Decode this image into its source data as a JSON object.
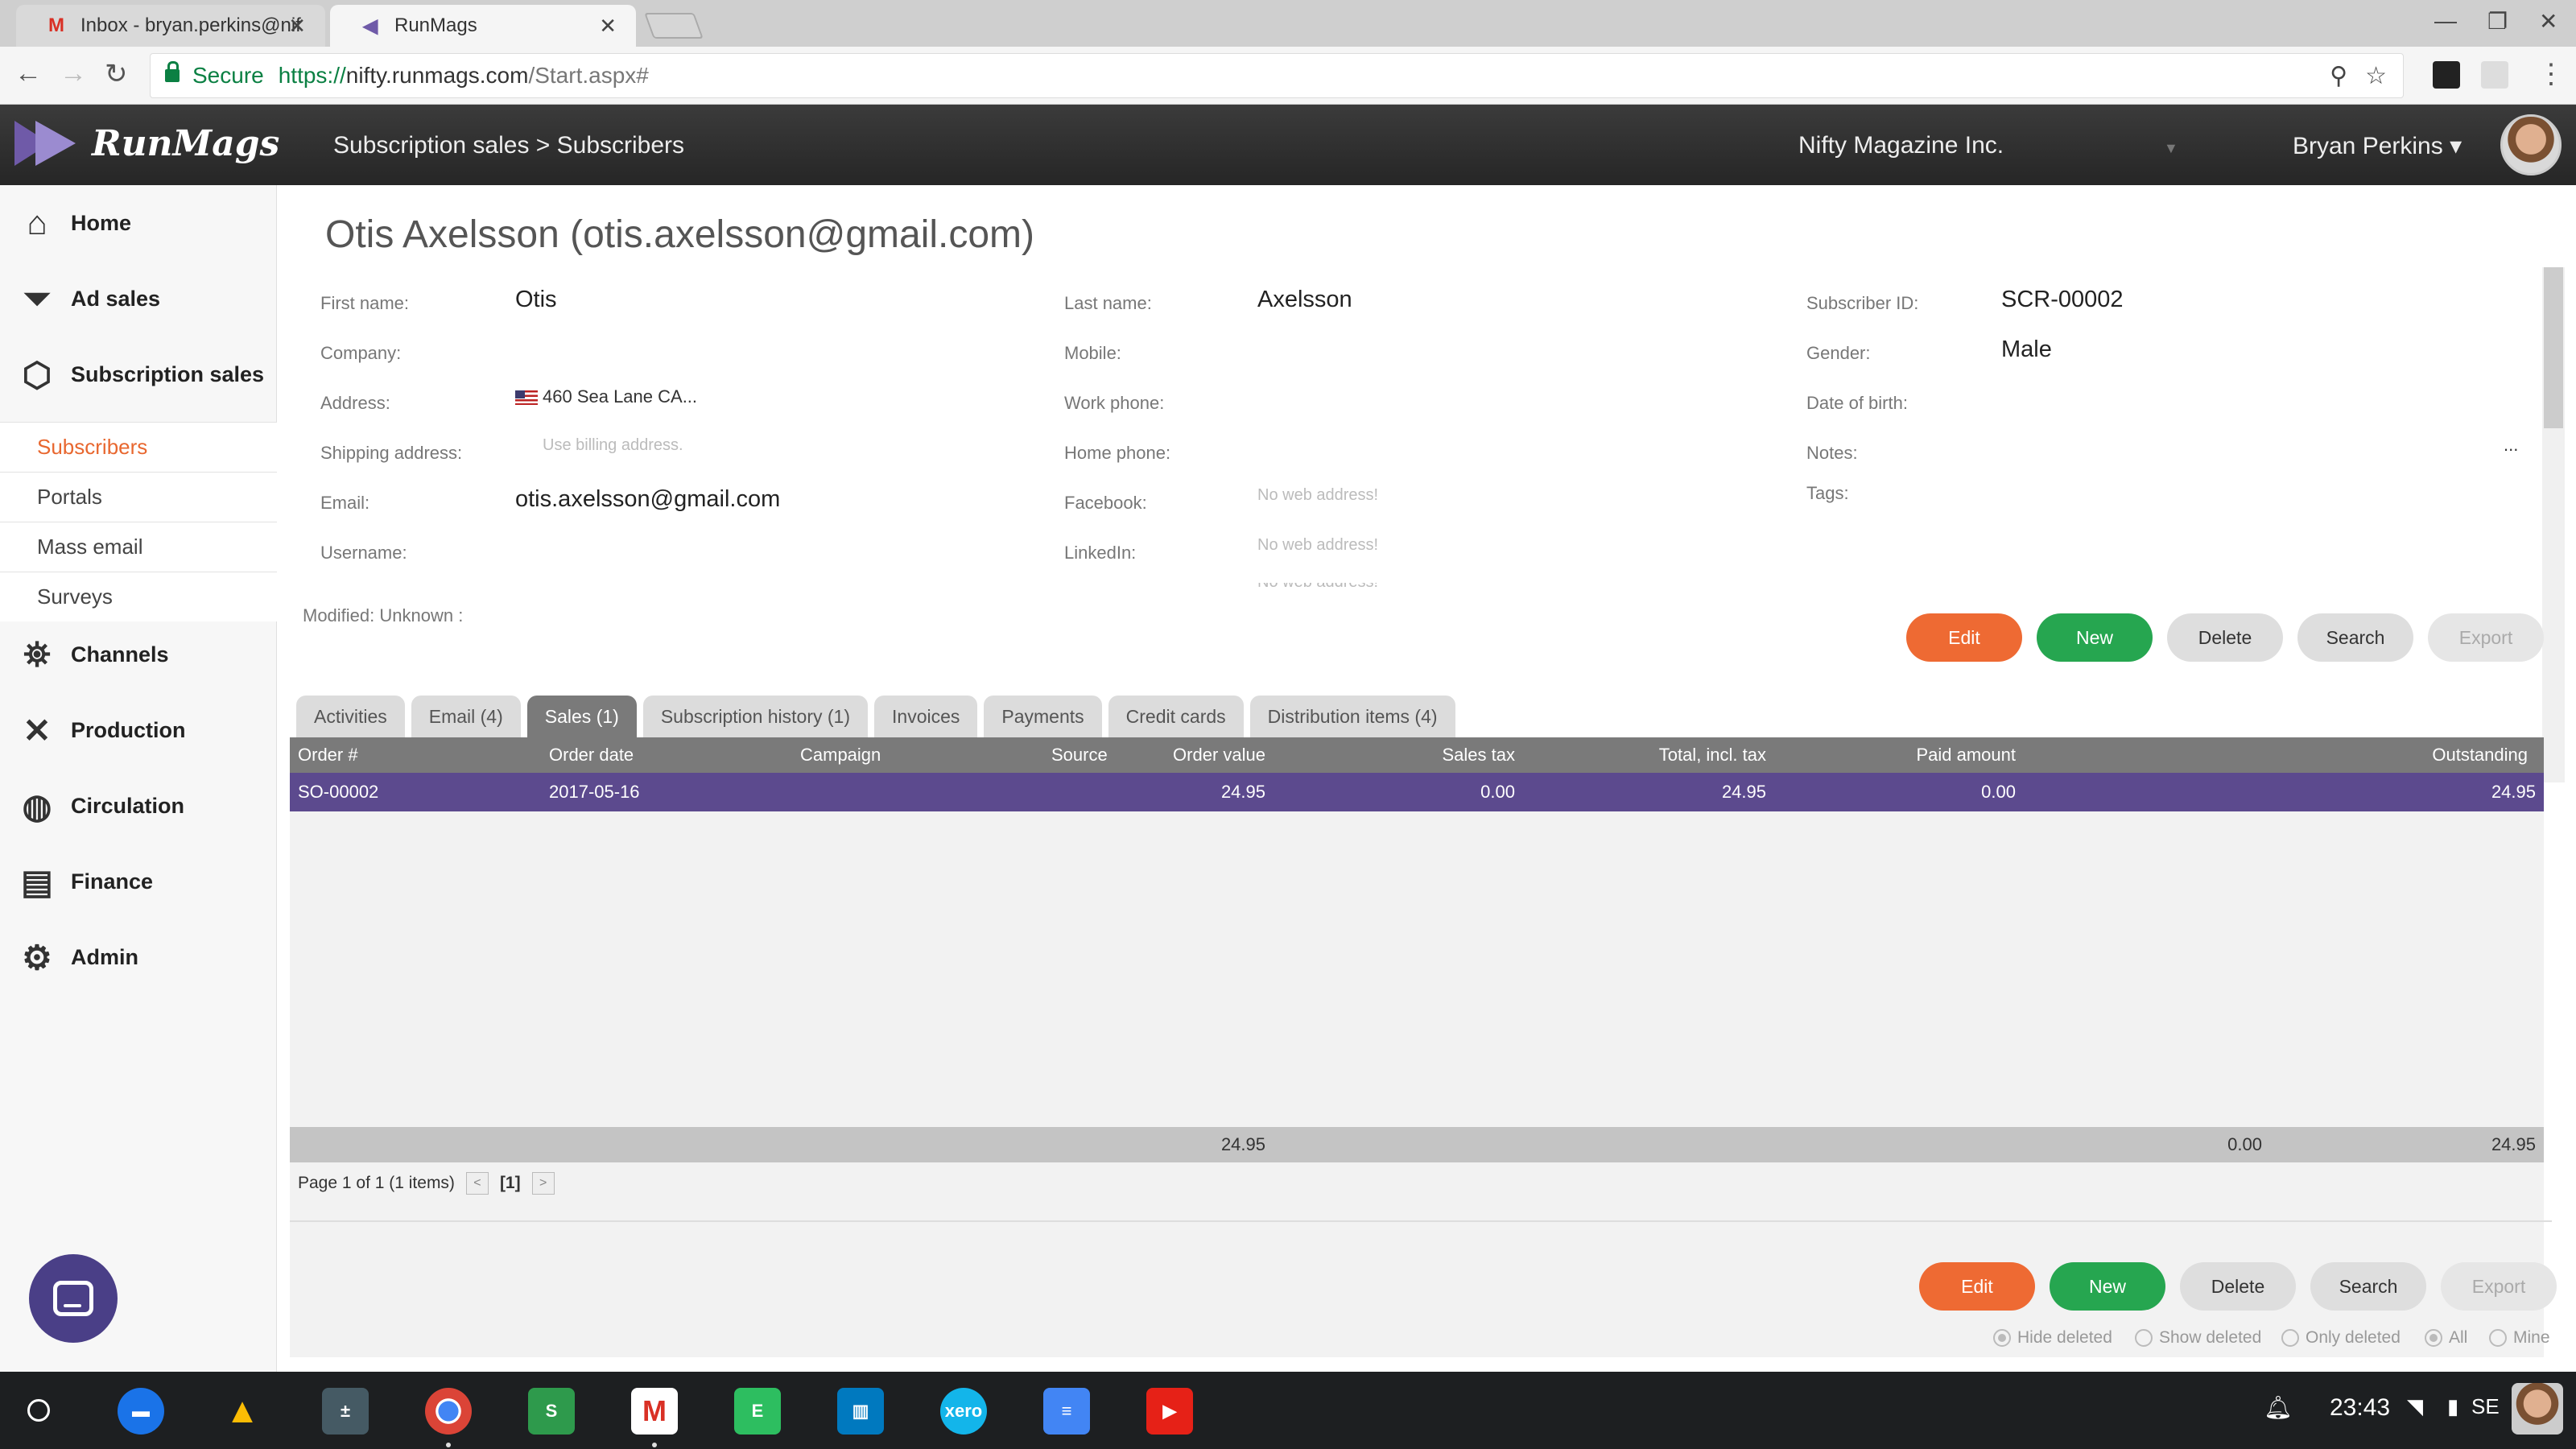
{
  "browser": {
    "tabs": [
      {
        "title": "Inbox - bryan.perkins@nif",
        "icon": "gmail-icon"
      },
      {
        "title": "RunMags",
        "icon": "runmags-icon"
      }
    ],
    "secure_label": "Secure",
    "url_scheme": "https://",
    "url_host": "nifty.runmags.com",
    "url_path": "/Start.aspx#"
  },
  "header": {
    "brand": "RunMags",
    "breadcrumb": "Subscription sales > Subscribers",
    "company": "Nifty Magazine Inc.",
    "user": "Bryan Perkins"
  },
  "sidebar": {
    "items": [
      {
        "label": "Home",
        "icon": "home-icon"
      },
      {
        "label": "Ad sales",
        "icon": "funnel-icon"
      },
      {
        "label": "Subscription sales",
        "icon": "box-icon"
      },
      {
        "label": "Channels",
        "icon": "satellite-icon"
      },
      {
        "label": "Production",
        "icon": "tools-icon"
      },
      {
        "label": "Circulation",
        "icon": "globe-icon"
      },
      {
        "label": "Finance",
        "icon": "wallet-icon"
      },
      {
        "label": "Admin",
        "icon": "gear-icon"
      }
    ],
    "subitems": [
      {
        "label": "Subscribers",
        "active": true
      },
      {
        "label": "Portals"
      },
      {
        "label": "Mass email"
      },
      {
        "label": "Surveys"
      }
    ]
  },
  "record": {
    "title": "Otis Axelsson (otis.axelsson@gmail.com)",
    "labels": {
      "first_name": "First name:",
      "company": "Company:",
      "address": "Address:",
      "shipping_address": "Shipping address:",
      "email": "Email:",
      "username": "Username:",
      "last_name": "Last name:",
      "mobile": "Mobile:",
      "work_phone": "Work phone:",
      "home_phone": "Home phone:",
      "facebook": "Facebook:",
      "linkedin": "LinkedIn:",
      "subscriber_id": "Subscriber ID:",
      "gender": "Gender:",
      "date_of_birth": "Date of birth:",
      "notes": "Notes:",
      "tags": "Tags:"
    },
    "values": {
      "first_name": "Otis",
      "address": "460 Sea Lane CA...",
      "shipping_address_placeholder": "Use billing address.",
      "email": "otis.axelsson@gmail.com",
      "last_name": "Axelsson",
      "facebook_placeholder": "No web address!",
      "linkedin_placeholder": "No web address!",
      "extra_placeholder": "No web address!",
      "subscriber_id": "SCR-00002",
      "gender": "Male",
      "notes_more": "..."
    },
    "modified": "Modified: Unknown :"
  },
  "actions": {
    "edit": "Edit",
    "new": "New",
    "delete": "Delete",
    "search": "Search",
    "export": "Export"
  },
  "tabs": [
    {
      "label": "Activities"
    },
    {
      "label": "Email (4)"
    },
    {
      "label": "Sales (1)",
      "active": true
    },
    {
      "label": "Subscription history (1)"
    },
    {
      "label": "Invoices"
    },
    {
      "label": "Payments"
    },
    {
      "label": "Credit cards"
    },
    {
      "label": "Distribution items (4)"
    }
  ],
  "grid": {
    "columns": [
      "Order #",
      "Order date",
      "Campaign",
      "Source",
      "Order value",
      "Sales tax",
      "Total, incl. tax",
      "Paid amount",
      "Outstanding"
    ],
    "rows": [
      [
        "SO-00002",
        "2017-05-16",
        "",
        "",
        "24.95",
        "0.00",
        "24.95",
        "0.00",
        "24.95"
      ]
    ],
    "footer": {
      "order_value": "24.95",
      "paid_amount": "0.00",
      "outstanding": "24.95"
    },
    "pager_text": "Page 1 of 1 (1 items)",
    "current_page": "[1]",
    "prev": "<",
    "next": ">"
  },
  "filters": [
    {
      "label": "Hide deleted",
      "checked": true
    },
    {
      "label": "Show deleted"
    },
    {
      "label": "Only deleted"
    },
    {
      "label": "All",
      "checked": true
    },
    {
      "label": "Mine"
    }
  ],
  "shelf": {
    "time": "23:43",
    "locale": "SE",
    "apps": [
      "files-icon",
      "drive-icon",
      "calculator-icon",
      "chrome-icon",
      "slides-icon",
      "gmail-icon",
      "evernote-icon",
      "trello-icon",
      "xero-icon",
      "docs-icon",
      "youtube-icon"
    ],
    "xero_label": "xero"
  },
  "colors": {
    "accent_orange": "#ee6a33",
    "accent_green": "#26a650",
    "selected_row": "#5c4a8e",
    "header_dark": "#2e2e2e"
  }
}
